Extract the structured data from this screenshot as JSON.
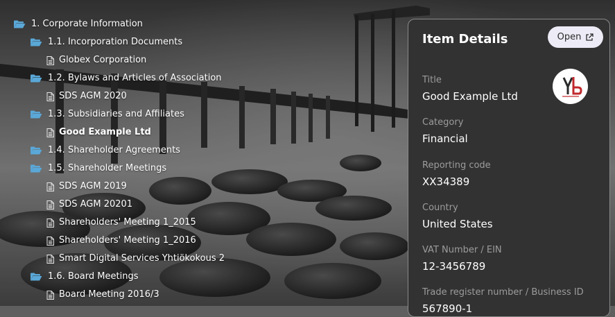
{
  "tree": {
    "items": [
      {
        "label": "1. Corporate Information",
        "type": "folder",
        "level": 0
      },
      {
        "label": "1.1. Incorporation Documents",
        "type": "folder",
        "level": 1
      },
      {
        "label": "Globex Corporation",
        "type": "document",
        "level": 2
      },
      {
        "label": "1.2. Bylaws and Articles of Association",
        "type": "folder",
        "level": 1
      },
      {
        "label": "SDS AGM 2020",
        "type": "document",
        "level": 2
      },
      {
        "label": "1.3. Subsidiaries and Affiliates",
        "type": "folder",
        "level": 1
      },
      {
        "label": "Good Example Ltd",
        "type": "document",
        "level": 2,
        "selected": true
      },
      {
        "label": "1.4. Shareholder Agreements",
        "type": "folder",
        "level": 1
      },
      {
        "label": "1.5. Shareholder Meetings",
        "type": "folder",
        "level": 1
      },
      {
        "label": "SDS AGM 2019",
        "type": "document",
        "level": 2
      },
      {
        "label": "SDS AGM 20201",
        "type": "document",
        "level": 2
      },
      {
        "label": "Shareholders' Meeting 1_2015",
        "type": "document",
        "level": 2
      },
      {
        "label": "Shareholders' Meeting 1_2016",
        "type": "document",
        "level": 2
      },
      {
        "label": "Smart Digital Services Yhtiökokous 2",
        "type": "document",
        "level": 2
      },
      {
        "label": "1.6. Board Meetings",
        "type": "folder",
        "level": 1
      },
      {
        "label": "Board Meeting 2016/3",
        "type": "document",
        "level": 2
      }
    ]
  },
  "details": {
    "title": "Item Details",
    "open_label": "Open",
    "fields": [
      {
        "label": "Title",
        "value": "Good Example Ltd"
      },
      {
        "label": "Category",
        "value": "Financial"
      },
      {
        "label": "Reporting code",
        "value": "XX34389"
      },
      {
        "label": "Country",
        "value": "United States"
      },
      {
        "label": "VAT Number / EIN",
        "value": "12-3456789"
      },
      {
        "label": "Trade register number / Business ID",
        "value": "567890-1"
      }
    ]
  },
  "icons": {
    "folder": "folder-open-icon",
    "document": "document-icon",
    "open": "external-link-icon"
  },
  "colors": {
    "folder_icon": "#5aa8d8",
    "panel_bg": "#323232",
    "panel_border": "#8a8a8a",
    "button_bg": "#ecebf6",
    "label_gray": "#9c9c9c",
    "logo_red": "#c0282d"
  }
}
